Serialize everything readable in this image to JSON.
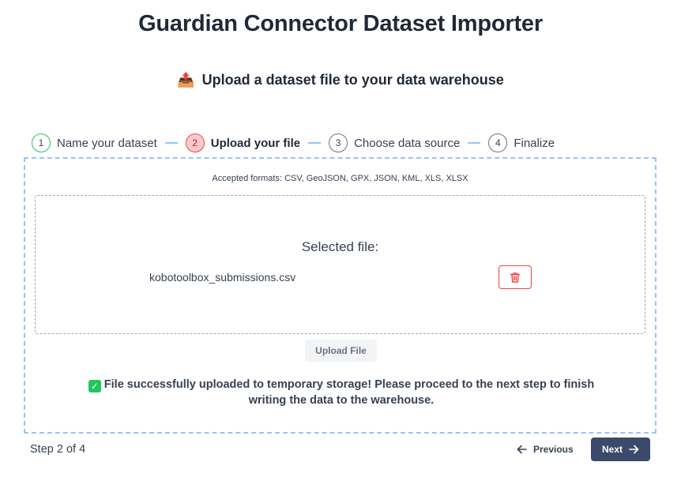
{
  "header": {
    "title": "Guardian Connector Dataset Importer",
    "subtitle_icon": "📤",
    "subtitle": "Upload a dataset file to your data warehouse"
  },
  "stepper": {
    "steps": [
      {
        "number": "1",
        "label": "Name your dataset",
        "state": "done"
      },
      {
        "number": "2",
        "label": "Upload your file",
        "state": "active"
      },
      {
        "number": "3",
        "label": "Choose data source",
        "state": "pending"
      },
      {
        "number": "4",
        "label": "Finalize",
        "state": "pending"
      }
    ]
  },
  "upload": {
    "formats": "Accepted formats: CSV, GeoJSON, GPX, JSON, KML, XLS, XLSX",
    "selected_heading": "Selected file:",
    "file_name": "kobotoolbox_submissions.csv",
    "upload_button": "Upload File",
    "success_icon": "✓",
    "success_message": "File successfully uploaded to temporary storage! Please proceed to the next step to finish writing the data to the warehouse."
  },
  "footer": {
    "step_count": "Step 2 of 4",
    "previous_label": "Previous",
    "next_label": "Next"
  },
  "colors": {
    "accent_dark": "#3b4a6b",
    "active_step": "#ef4444",
    "done_step": "#22c55e",
    "dropzone_border": "#93c5fd"
  }
}
